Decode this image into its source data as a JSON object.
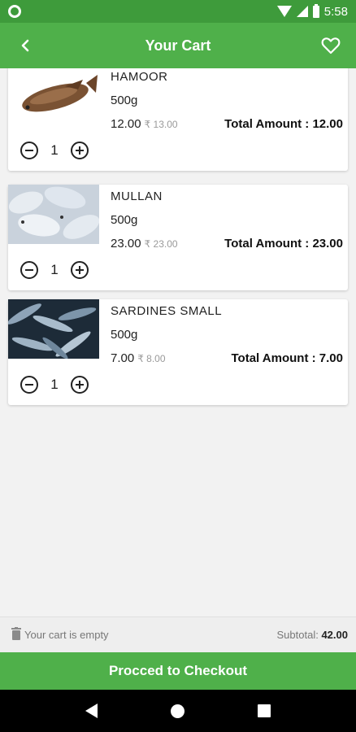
{
  "status": {
    "time": "5:58"
  },
  "header": {
    "title": "Your Cart"
  },
  "items": [
    {
      "name": "HAMOOR",
      "weight": "500g",
      "price": "12.00",
      "mrp": "₹ 13.00",
      "total": "Total Amount : 12.00",
      "qty": "1"
    },
    {
      "name": "MULLAN",
      "weight": "500g",
      "price": "23.00",
      "mrp": "₹ 23.00",
      "total": "Total Amount : 23.00",
      "qty": "1"
    },
    {
      "name": "SARDINES SMALL",
      "weight": "500g",
      "price": "7.00",
      "mrp": "₹ 8.00",
      "total": "Total Amount : 7.00",
      "qty": "1"
    }
  ],
  "footer": {
    "empty_label": "Your cart is empty",
    "subtotal_label": "Subtotal:",
    "subtotal_value": "42.00"
  },
  "checkout": {
    "label": "Procced to Checkout"
  },
  "colors": {
    "primary": "#4fb04a",
    "status": "#3e9b3b"
  }
}
